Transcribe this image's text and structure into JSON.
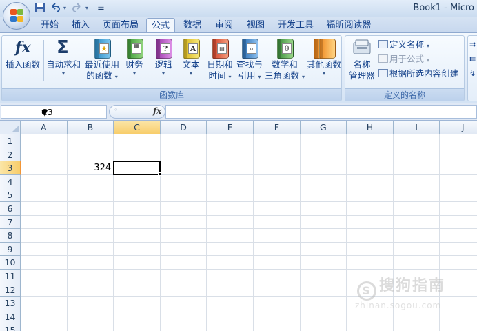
{
  "window": {
    "title": "Book1 - Micro"
  },
  "quick_access": {
    "undo_icon": "undo-icon",
    "redo_icon": "redo-icon",
    "customize": "≡"
  },
  "tabs": [
    {
      "label": "开始"
    },
    {
      "label": "插入"
    },
    {
      "label": "页面布局"
    },
    {
      "label": "公式",
      "active": true
    },
    {
      "label": "数据"
    },
    {
      "label": "审阅"
    },
    {
      "label": "视图"
    },
    {
      "label": "开发工具"
    },
    {
      "label": "福昕阅读器"
    }
  ],
  "ribbon": {
    "function_library": {
      "label": "函数库",
      "buttons": [
        {
          "label1": "插入函数",
          "label2": ""
        },
        {
          "label1": "自动求和",
          "label2": ""
        },
        {
          "label1": "最近使用",
          "label2": "的函数"
        },
        {
          "label1": "财务",
          "label2": ""
        },
        {
          "label1": "逻辑",
          "label2": ""
        },
        {
          "label1": "文本",
          "label2": ""
        },
        {
          "label1": "日期和",
          "label2": "时间"
        },
        {
          "label1": "查找与",
          "label2": "引用"
        },
        {
          "label1": "数学和",
          "label2": "三角函数"
        },
        {
          "label1": "其他函数",
          "label2": ""
        }
      ]
    },
    "defined_names": {
      "label": "定义的名称",
      "name_manager": {
        "label1": "名称",
        "label2": "管理器"
      },
      "define_name": "定义名称",
      "use_in_formula": "用于公式",
      "create_from_selection": "根据所选内容创建"
    }
  },
  "formula_bar": {
    "name_box": "C3",
    "fx": "fx",
    "value": ""
  },
  "sheet": {
    "columns": [
      "A",
      "B",
      "C",
      "D",
      "E",
      "F",
      "G",
      "H",
      "I",
      "J"
    ],
    "rows": [
      "1",
      "2",
      "3",
      "4",
      "5",
      "6",
      "7",
      "8",
      "9",
      "10",
      "11",
      "12",
      "13",
      "14",
      "15"
    ],
    "selected_column": "C",
    "selected_row": "3",
    "cells": {
      "B3": "324"
    }
  },
  "watermark": {
    "text": "搜狗指南",
    "sub": "zhinan.sogou.com"
  }
}
